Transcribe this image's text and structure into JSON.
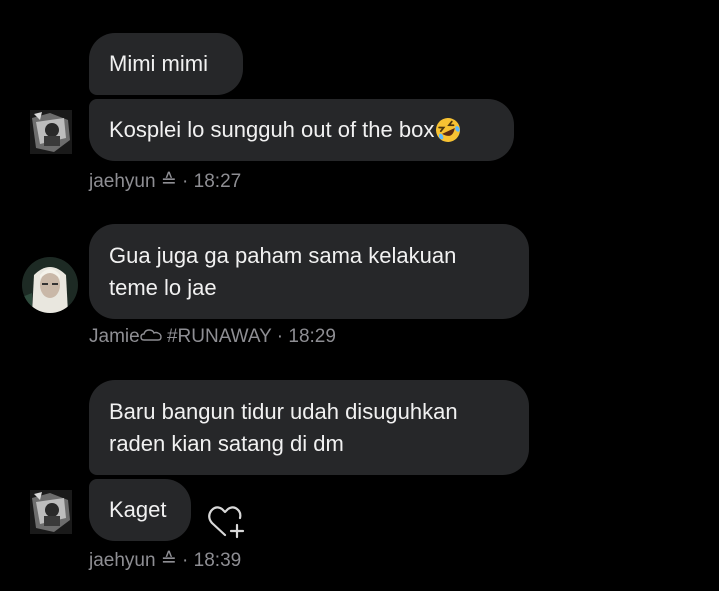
{
  "messages": [
    {
      "text": "Mimi mimi"
    },
    {
      "text": "Kosplei lo sungguh out of the box",
      "emoji": "rolling-on-floor-laughing"
    },
    {
      "text": "Gua juga ga paham sama kelakuan teme lo jae",
      "line1": "Gua juga ga paham sama kelakuan",
      "line2": "teme lo jae"
    },
    {
      "text": "Baru bangun tidur udah disuguhkan raden kian satang di dm",
      "line1": "Baru bangun tidur udah disuguhkan",
      "line2": "raden kian satang di dm"
    },
    {
      "text": "Kaget"
    }
  ],
  "meta": [
    {
      "author": "jaehyun",
      "badge": "≙",
      "separator": "·",
      "time": "18:27"
    },
    {
      "author": "Jamie",
      "badge": "#RUNAWAY",
      "separator": "·",
      "time": "18:29"
    },
    {
      "author": "jaehyun",
      "badge": "≙",
      "separator": "·",
      "time": "18:39"
    }
  ],
  "colors": {
    "background": "#000000",
    "bubble": "#262729",
    "text": "#f1f1f1",
    "meta": "#8e8e93"
  },
  "icons": {
    "react": "heart-plus-icon",
    "emoji": "rolling-on-floor-laughing-emoji"
  }
}
